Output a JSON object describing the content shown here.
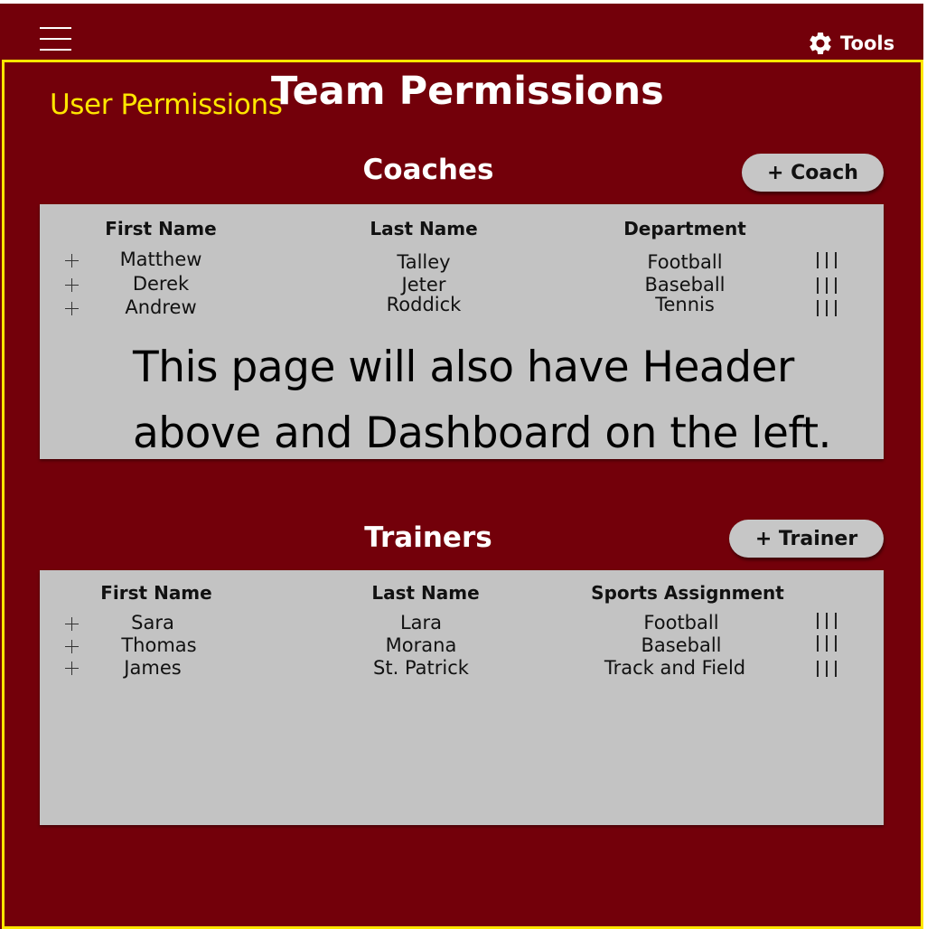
{
  "header": {
    "menu_icon": "hamburger-icon",
    "tools_icon": "gear-icon",
    "tools_label": "Tools"
  },
  "page": {
    "section_label": "User Permissions",
    "title": "Team Permissions"
  },
  "coaches": {
    "title": "Coaches",
    "add_label": "+ Coach",
    "columns": [
      "First Name",
      "Last Name",
      "Department"
    ],
    "rows": [
      {
        "first": "Matthew",
        "last": "Talley",
        "dept": "Football"
      },
      {
        "first": "Derek",
        "last": "Jeter",
        "dept": "Baseball"
      },
      {
        "first": "Andrew",
        "last": "Roddick",
        "dept": "Tennis"
      }
    ]
  },
  "trainers": {
    "title": "Trainers",
    "add_label": "+ Trainer",
    "columns": [
      "First Name",
      "Last Name",
      "Sports Assignment"
    ],
    "rows": [
      {
        "first": "Sara",
        "last": "Lara",
        "sport": "Football"
      },
      {
        "first": "Thomas",
        "last": "Morana",
        "sport": "Baseball"
      },
      {
        "first": "James",
        "last": "St. Patrick",
        "sport": "Track and Field"
      }
    ]
  },
  "note": "This page will also have Header above and Dashboard on the left.",
  "colors": {
    "background": "#73000a",
    "frame": "#ffe600",
    "panel": "#c3c3c3",
    "button": "#c6c6c6"
  }
}
